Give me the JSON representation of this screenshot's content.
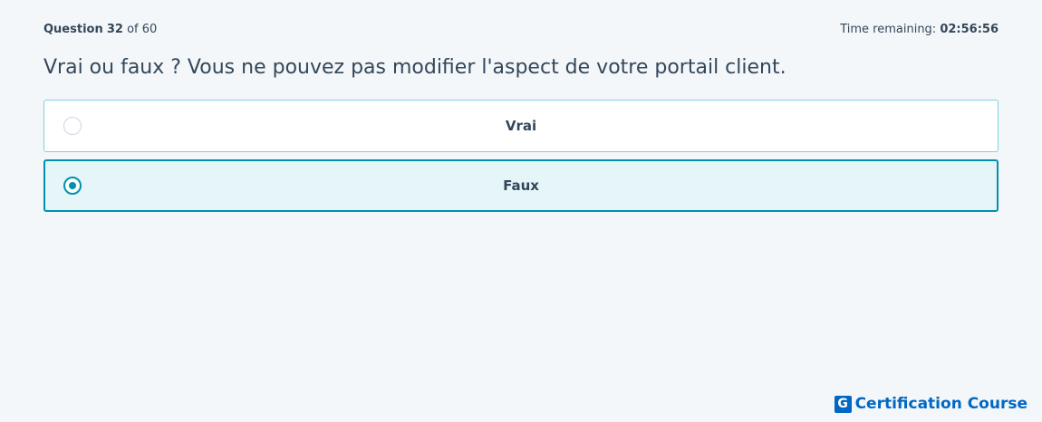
{
  "header": {
    "question_word": "Question",
    "question_number": "32",
    "of_total": "of 60",
    "time_label": "Time remaining:",
    "time_value": "02:56:56"
  },
  "question": {
    "text": "Vrai ou faux ? Vous ne pouvez pas modifier l'aspect de votre portail client."
  },
  "options": [
    {
      "label": "Vrai",
      "selected": false
    },
    {
      "label": "Faux",
      "selected": true
    }
  ],
  "brand": {
    "logo_letter": "G",
    "name": "Certification Course",
    "color": "#0068c4"
  },
  "colors": {
    "accent": "#0091ae",
    "selected_bg": "#e5f5f8",
    "option_border": "#7fd1de",
    "text": "#33475b"
  }
}
